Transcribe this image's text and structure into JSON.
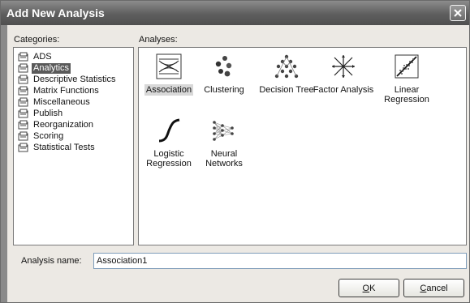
{
  "window": {
    "title": "Add New Analysis"
  },
  "categories": {
    "label": "Categories:",
    "items": [
      {
        "label": "ADS",
        "selected": false
      },
      {
        "label": "Analytics",
        "selected": true
      },
      {
        "label": "Descriptive Statistics",
        "selected": false
      },
      {
        "label": "Matrix Functions",
        "selected": false
      },
      {
        "label": "Miscellaneous",
        "selected": false
      },
      {
        "label": "Publish",
        "selected": false
      },
      {
        "label": "Reorganization",
        "selected": false
      },
      {
        "label": "Scoring",
        "selected": false
      },
      {
        "label": "Statistical Tests",
        "selected": false
      }
    ],
    "icon": "folder-icon"
  },
  "analyses": {
    "label": "Analyses:",
    "items": [
      {
        "label": "Association",
        "icon": "association-icon",
        "selected": true
      },
      {
        "label": "Clustering",
        "icon": "clustering-icon",
        "selected": false
      },
      {
        "label": "Decision Tree",
        "icon": "decision-tree-icon",
        "selected": false
      },
      {
        "label": "Factor Analysis",
        "icon": "factor-analysis-icon",
        "selected": false
      },
      {
        "label": "Linear Regression",
        "icon": "linear-regression-icon",
        "selected": false
      },
      {
        "label": "Logistic Regression",
        "icon": "logistic-regression-icon",
        "selected": false
      },
      {
        "label": "Neural Networks",
        "icon": "neural-networks-icon",
        "selected": false
      }
    ]
  },
  "analysis_name": {
    "label": "Analysis name:",
    "value": "Association1"
  },
  "buttons": {
    "ok_mnemonic": "O",
    "ok_rest": "K",
    "cancel_mnemonic": "C",
    "cancel_rest": "ancel"
  },
  "colors": {
    "selection": "#5a5a5a",
    "title_bar": "#5e5e5e",
    "dialog_bg": "#ece9e4"
  }
}
